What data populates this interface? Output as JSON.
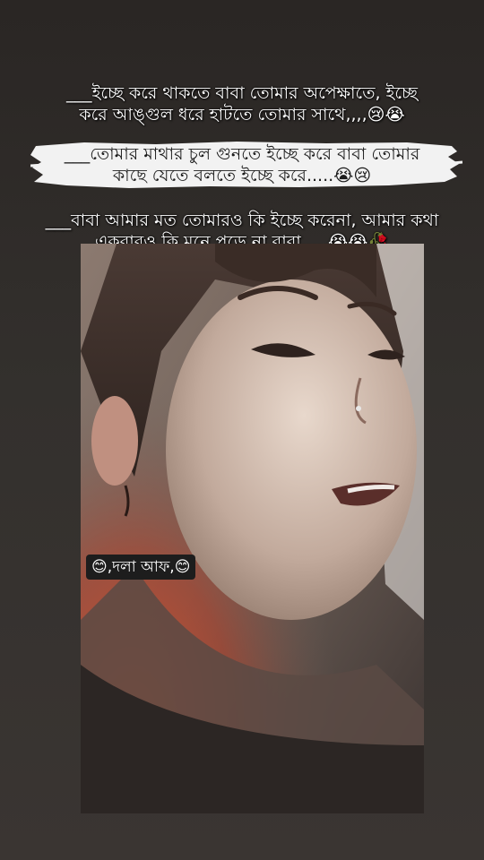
{
  "captions": [
    {
      "line1": "___ইচ্ছে করে থাকতে বাবা তোমার অপেক্ষাতে, ইচ্ছে",
      "line2": "করে আঙ্গুল ধরে হাটতে তোমার সাথে,,,,😢😭"
    },
    {
      "line1": "___তোমার মাথার চুল গুনতে ইচ্ছে করে বাবা তোমার",
      "line2": "কাছে যেতে বলতে ইচ্ছে করে.....😭😢"
    },
    {
      "line1": "___বাবা আমার মত তোমারও কি ইচ্ছে করেনা, আমার কথা",
      "line2": "একবারও কি মনে পড়ে না বাবা,,,,,😭😭🥀"
    }
  ],
  "sticker_text": "😊,দলা আফ,😊",
  "colors": {
    "background": "#2e2a27",
    "caption_text": "#ffffff",
    "brush_highlight": "#f2f2f2",
    "sticker_bg": "#1d1d1d",
    "photo_warm_glow": "#d0462a"
  }
}
